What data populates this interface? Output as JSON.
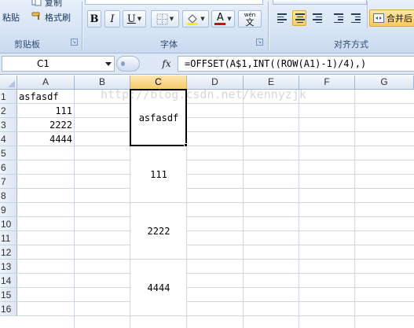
{
  "ribbon": {
    "clipboard": {
      "paste_label": "粘贴",
      "copy_label": "复制",
      "format_painter_label": "格式刷",
      "group_label": "剪贴板"
    },
    "font": {
      "bold_label": "B",
      "italic_label": "I",
      "underline_label": "U",
      "font_color_label": "A",
      "phonetic_label": "wén",
      "phonetic_char": "文",
      "group_label": "字体"
    },
    "alignment": {
      "merge_center_label": "合并后",
      "group_label": "对齐方式"
    }
  },
  "formula_bar": {
    "name_box": "C1",
    "fx_label": "fx",
    "formula": "=OFFSET(A$1,INT((ROW(A1)-1)/4),)"
  },
  "sheet": {
    "columns": [
      "A",
      "B",
      "C",
      "D",
      "E",
      "F",
      "G"
    ],
    "selected_column": "C",
    "rows": [
      "1",
      "2",
      "3",
      "4",
      "5",
      "6",
      "7",
      "8",
      "9",
      "10",
      "11",
      "12",
      "13",
      "14",
      "15",
      "16"
    ],
    "cells": {
      "A1": "asfasdf",
      "A2": "111",
      "A3": "2222",
      "A4": "4444",
      "C1": "asfasdf",
      "C5": "111",
      "C9": "2222",
      "C13": "4444"
    },
    "watermark": "http://blog.csdn.net/kennyzjk"
  },
  "colors": {
    "selection_header": "#f8c96a",
    "gridline": "#d0d7e5",
    "ribbon": "#dbe7f6"
  }
}
